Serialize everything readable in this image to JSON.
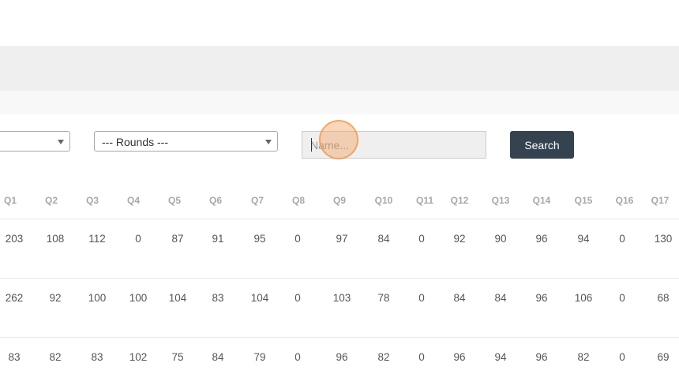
{
  "filters": {
    "left_select_value": "",
    "rounds_select_value": "--- Rounds ---",
    "name_placeholder": "Name...",
    "search_label": "Search"
  },
  "table": {
    "columns": [
      "Q1",
      "Q2",
      "Q3",
      "Q4",
      "Q5",
      "Q6",
      "Q7",
      "Q8",
      "Q9",
      "Q10",
      "Q11",
      "Q12",
      "Q13",
      "Q14",
      "Q15",
      "Q16",
      "Q17"
    ],
    "rows": [
      [
        "203",
        "108",
        "112",
        "0",
        "87",
        "91",
        "95",
        "0",
        "97",
        "84",
        "0",
        "92",
        "90",
        "96",
        "94",
        "0",
        "130"
      ],
      [
        "262",
        "92",
        "100",
        "100",
        "104",
        "83",
        "104",
        "0",
        "103",
        "78",
        "0",
        "84",
        "84",
        "96",
        "106",
        "0",
        "68"
      ],
      [
        "83",
        "82",
        "83",
        "102",
        "75",
        "84",
        "79",
        "0",
        "96",
        "82",
        "0",
        "96",
        "94",
        "96",
        "82",
        "0",
        "69"
      ]
    ]
  },
  "colors": {
    "search_button": "#35424f",
    "header_text": "#a8a8a8",
    "click_indicator": "#f4a05a"
  },
  "icons": {
    "select_caret": "chevron-down-icon"
  }
}
